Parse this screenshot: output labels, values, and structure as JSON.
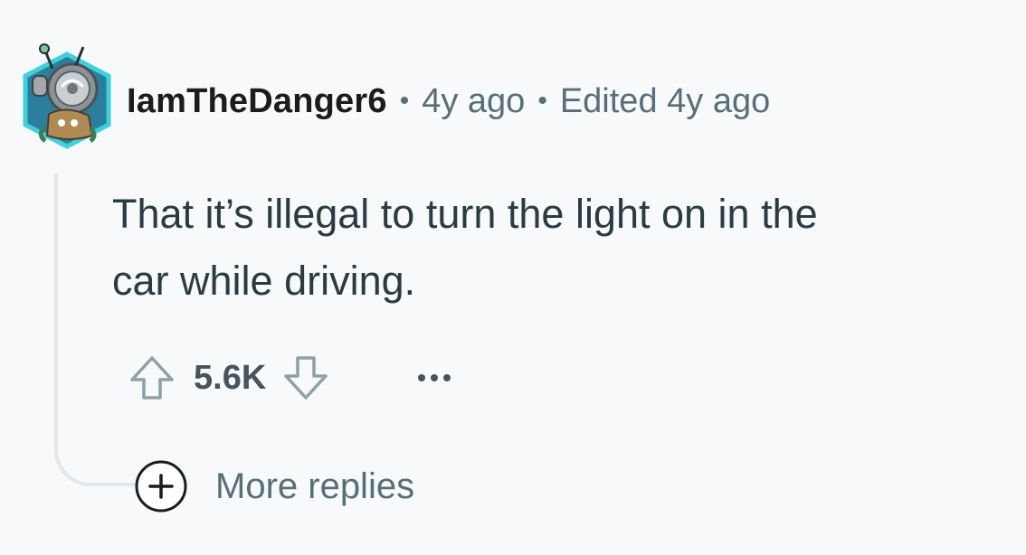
{
  "comment": {
    "author": "IamTheDanger6",
    "separator": "•",
    "posted": "4y ago",
    "edited": "Edited 4y ago",
    "body": [
      "That it’s illegal to turn the light on in the",
      "car while driving."
    ],
    "score": "5.6K"
  },
  "replies": {
    "label": "More replies"
  },
  "icons": {
    "upvote": "arrow-up-outline-icon",
    "downvote": "arrow-down-outline-icon",
    "more": "three-dots-horizontal-icon",
    "expand": "plus-circle-icon"
  },
  "colors": {
    "background": "#f7f9fa",
    "username": "#1c1c1c",
    "muted": "#576f76",
    "body_text": "#2a3c42",
    "avatar_frame": "#35c7d6"
  }
}
